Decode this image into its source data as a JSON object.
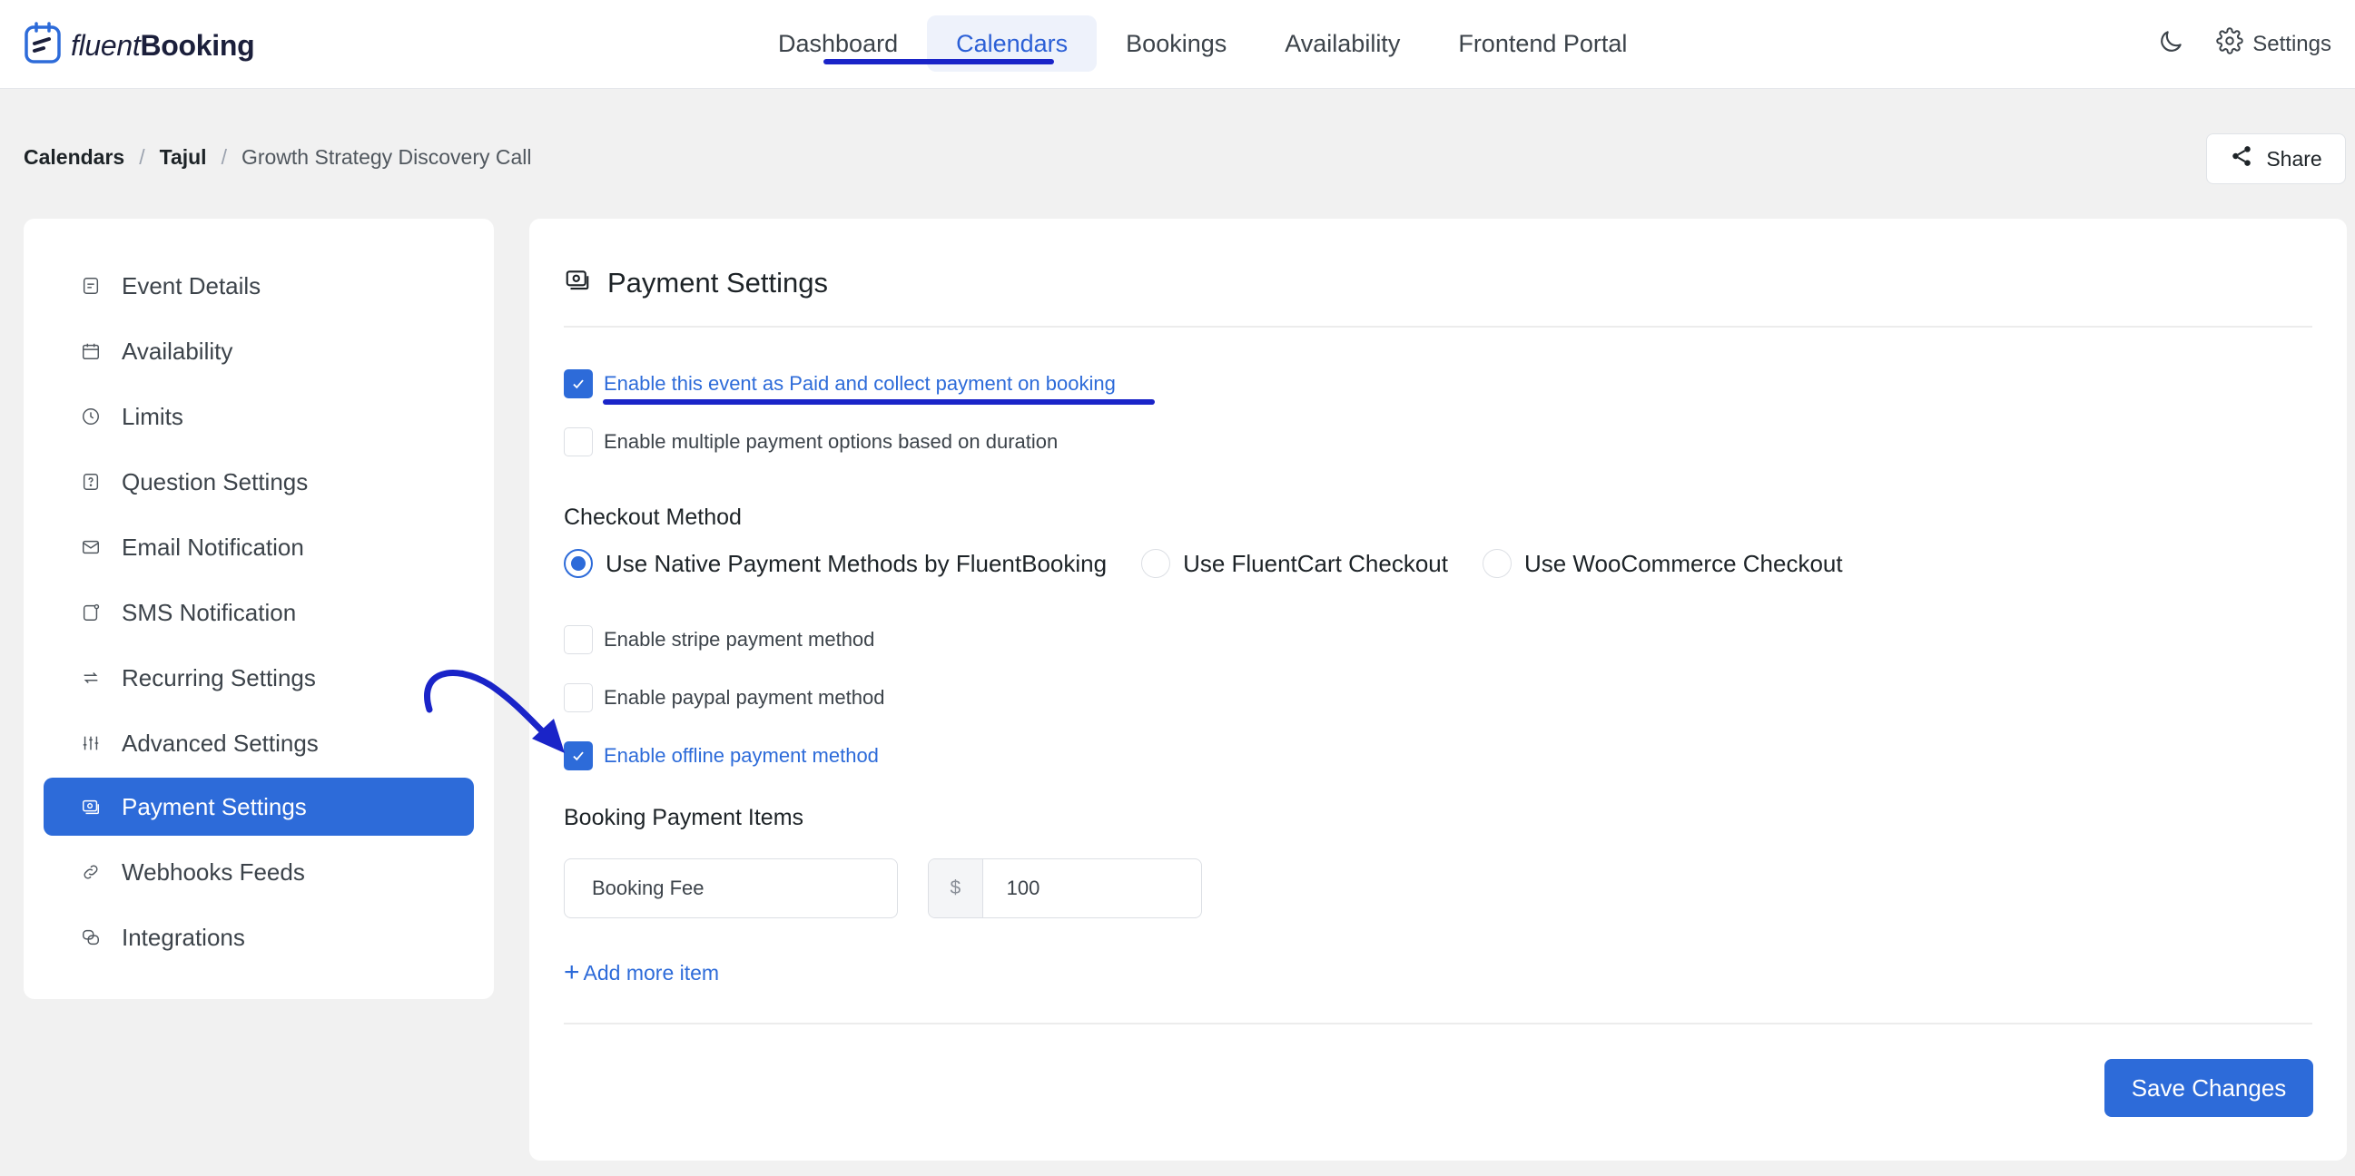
{
  "app": {
    "logo_light": "fluent",
    "logo_bold": "Booking"
  },
  "nav": {
    "items": [
      {
        "label": "Dashboard"
      },
      {
        "label": "Calendars"
      },
      {
        "label": "Bookings"
      },
      {
        "label": "Availability"
      },
      {
        "label": "Frontend Portal"
      }
    ],
    "active": "Calendars",
    "settings_label": "Settings"
  },
  "breadcrumb": {
    "items": [
      "Calendars",
      "Tajul",
      "Growth Strategy Discovery Call"
    ]
  },
  "share_label": "Share",
  "sidebar": {
    "items": [
      {
        "label": "Event Details",
        "icon": "document-icon"
      },
      {
        "label": "Availability",
        "icon": "calendar-icon"
      },
      {
        "label": "Limits",
        "icon": "clock-icon"
      },
      {
        "label": "Question Settings",
        "icon": "question-icon"
      },
      {
        "label": "Email Notification",
        "icon": "mail-icon"
      },
      {
        "label": "SMS Notification",
        "icon": "sms-icon"
      },
      {
        "label": "Recurring Settings",
        "icon": "repeat-icon"
      },
      {
        "label": "Advanced Settings",
        "icon": "sliders-icon"
      },
      {
        "label": "Payment Settings",
        "icon": "payment-icon"
      },
      {
        "label": "Webhooks Feeds",
        "icon": "link-icon"
      },
      {
        "label": "Integrations",
        "icon": "integrations-icon"
      }
    ],
    "active": "Payment Settings"
  },
  "payment": {
    "title": "Payment Settings",
    "enable_paid": {
      "label": "Enable this event as Paid and collect payment on booking",
      "checked": true
    },
    "multiple_options": {
      "label": "Enable multiple payment options based on duration",
      "checked": false
    },
    "checkout_method_label": "Checkout Method",
    "checkout_options": [
      {
        "label": "Use Native Payment Methods by FluentBooking",
        "selected": true
      },
      {
        "label": "Use FluentCart Checkout",
        "selected": false
      },
      {
        "label": "Use WooCommerce Checkout",
        "selected": false
      }
    ],
    "stripe": {
      "label": "Enable stripe payment method",
      "checked": false
    },
    "paypal": {
      "label": "Enable paypal payment method",
      "checked": false
    },
    "offline": {
      "label": "Enable offline payment method",
      "checked": true
    },
    "items_label": "Booking Payment Items",
    "item_name": "Booking Fee",
    "currency_symbol": "$",
    "item_amount": "100",
    "add_item_label": "Add more item",
    "save_label": "Save Changes"
  },
  "colors": {
    "accent": "#2d6bd9",
    "annotation": "#1a24c8"
  }
}
